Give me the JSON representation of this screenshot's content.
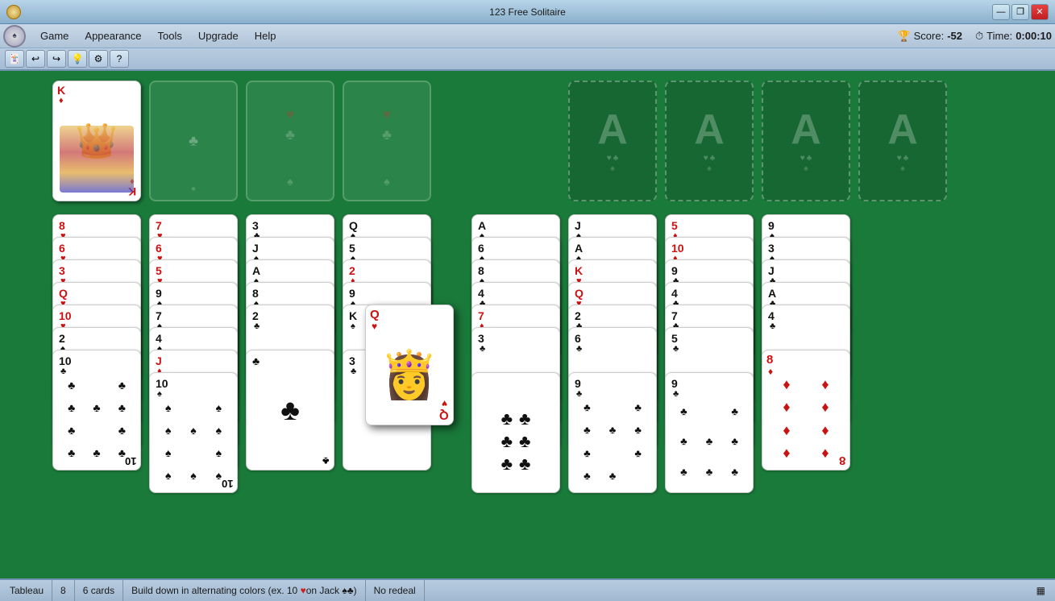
{
  "window": {
    "title": "123 Free Solitaire",
    "controls": [
      "minimize",
      "restore",
      "close"
    ]
  },
  "titlebar": {
    "title": "123 Free Solitaire"
  },
  "menubar": {
    "items": [
      "Game",
      "Appearance",
      "Tools",
      "Upgrade",
      "Help"
    ],
    "score_label": "Score:",
    "score_value": "-52",
    "time_label": "Time:",
    "time_value": "0:00:10"
  },
  "toolbar": {
    "buttons": [
      "new",
      "undo",
      "redo",
      "hint",
      "settings",
      "help"
    ]
  },
  "statusbar": {
    "game_type": "Tableau",
    "columns": "8",
    "cards": "6 cards",
    "rule": "Build down in alternating colors (ex. 10",
    "rule_suit": "♥",
    "rule_cont": " on Jack ♠♣)",
    "redeal": "No redeal",
    "grid_icon": "▦"
  }
}
